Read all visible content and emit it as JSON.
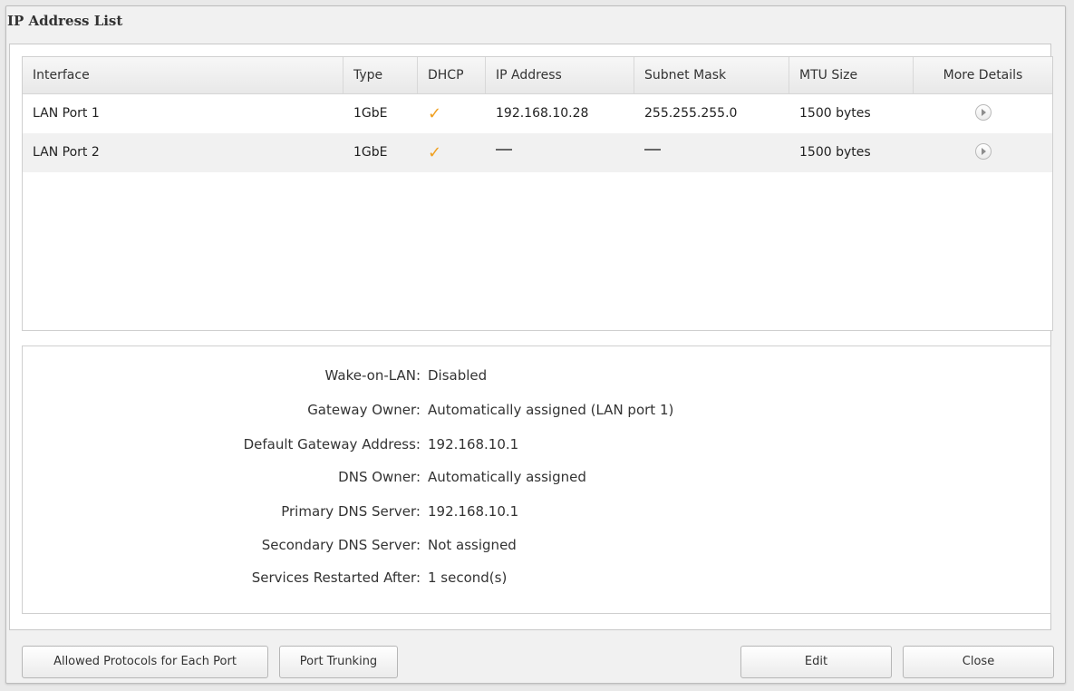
{
  "window": {
    "title": "IP Address List"
  },
  "table": {
    "headers": {
      "interface": "Interface",
      "type": "Type",
      "dhcp": "DHCP",
      "ip": "IP Address",
      "mask": "Subnet Mask",
      "mtu": "MTU Size",
      "more": "More Details"
    },
    "rows": [
      {
        "interface": "LAN Port 1",
        "type": "1GbE",
        "dhcp": "✓",
        "ip": "192.168.10.28",
        "mask": "255.255.255.0",
        "mtu": "1500 bytes"
      },
      {
        "interface": "LAN Port 2",
        "type": "1GbE",
        "dhcp": "✓",
        "ip": "",
        "mask": "",
        "mtu": "1500 bytes"
      }
    ]
  },
  "details": [
    {
      "label": "Wake-on-LAN:",
      "value": "Disabled"
    },
    {
      "label": "Gateway Owner:",
      "value": "Automatically assigned (LAN port 1)"
    },
    {
      "label": "Default Gateway Address:",
      "value": "192.168.10.1"
    },
    {
      "label": "DNS Owner:",
      "value": "Automatically assigned"
    },
    {
      "label": "Primary DNS Server:",
      "value": "192.168.10.1"
    },
    {
      "label": "Secondary DNS Server:",
      "value": "Not assigned"
    },
    {
      "label": "Services Restarted After:",
      "value": "1 second(s)"
    }
  ],
  "buttons": {
    "allowed_protocols": "Allowed Protocols for Each Port",
    "port_trunking": "Port Trunking",
    "edit": "Edit",
    "close": "Close"
  },
  "colors": {
    "check": "#f0a020",
    "row_alt": "#f1f1f1"
  }
}
